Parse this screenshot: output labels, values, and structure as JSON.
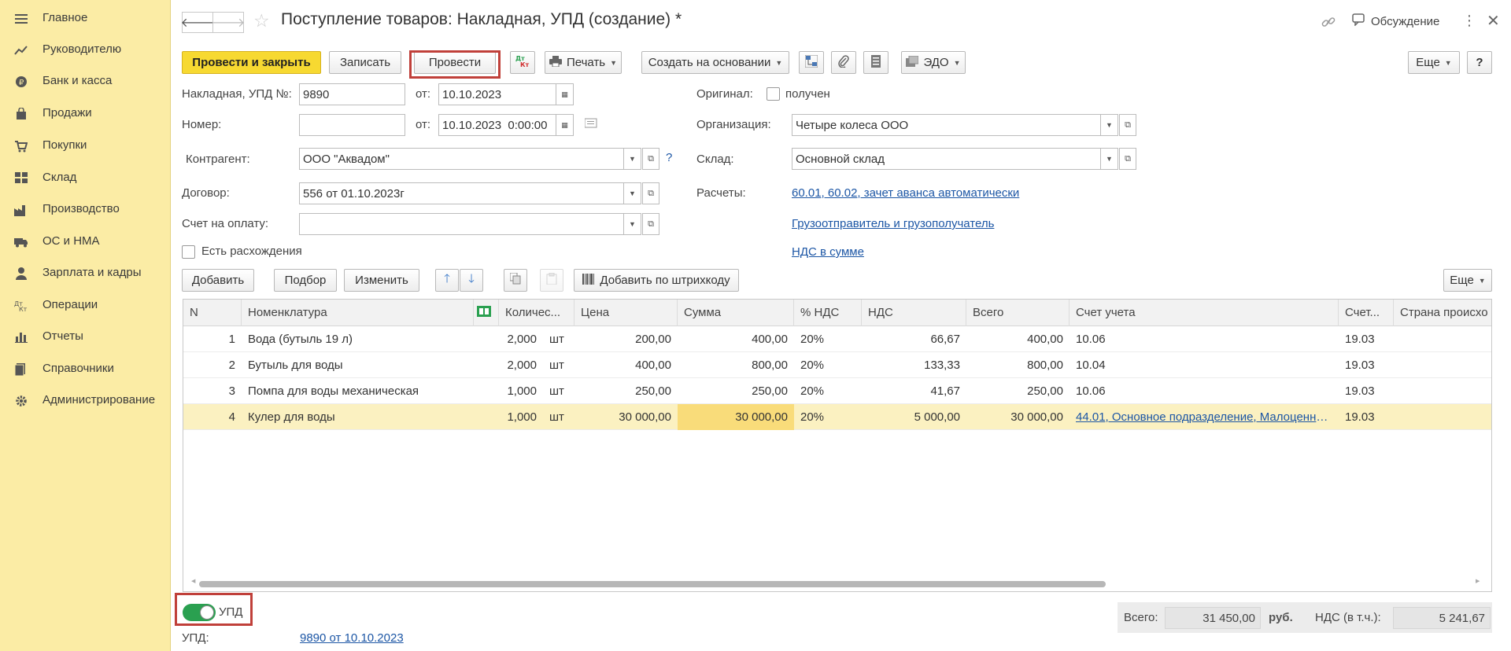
{
  "sidebar": {
    "items": [
      {
        "label": "Главное",
        "icon": "menu-icon"
      },
      {
        "label": "Руководителю",
        "icon": "trend-icon"
      },
      {
        "label": "Банк и касса",
        "icon": "coin-icon"
      },
      {
        "label": "Продажи",
        "icon": "bag-icon"
      },
      {
        "label": "Покупки",
        "icon": "cart-icon"
      },
      {
        "label": "Склад",
        "icon": "warehouse-icon"
      },
      {
        "label": "Производство",
        "icon": "factory-icon"
      },
      {
        "label": "ОС и НМА",
        "icon": "truck-icon"
      },
      {
        "label": "Зарплата и кадры",
        "icon": "person-icon"
      },
      {
        "label": "Операции",
        "icon": "dtkt-icon"
      },
      {
        "label": "Отчеты",
        "icon": "chart-icon"
      },
      {
        "label": "Справочники",
        "icon": "book-icon"
      },
      {
        "label": "Администрирование",
        "icon": "gear-icon"
      }
    ]
  },
  "header": {
    "title": "Поступление товаров: Накладная, УПД (создание) *",
    "discussion": "Обсуждение"
  },
  "toolbar": {
    "post_close": "Провести и закрыть",
    "save": "Записать",
    "post": "Провести",
    "print": "Печать",
    "create_based": "Создать на основании",
    "edo": "ЭДО",
    "more": "Еще",
    "help": "?"
  },
  "form": {
    "invoice_label": "Накладная, УПД №:",
    "invoice_number": "9890",
    "from_label": "от:",
    "invoice_date": "10.10.2023",
    "number_label": "Номер:",
    "number_value": "",
    "from_label2": "от:",
    "number_date": "10.10.2023  0:00:00",
    "counterparty_label": "Контрагент:",
    "counterparty": "ООО \"Аквадом\"",
    "contract_label": "Договор:",
    "contract": "556 от 01.10.2023г",
    "payment_label": "Счет на оплату:",
    "payment_value": "",
    "discrepancy_label": "Есть расхождения",
    "original_label": "Оригинал:",
    "received_label": "получен",
    "organization_label": "Организация:",
    "organization": "Четыре колеса ООО",
    "warehouse_label": "Склад:",
    "warehouse": "Основной склад",
    "settlements_label": "Расчеты:",
    "settlements_link": "60.01, 60.02, зачет аванса автоматически",
    "shipper_link": "Грузоотправитель и грузополучатель",
    "vat_link": "НДС в сумме",
    "help_mark": "?"
  },
  "table_toolbar": {
    "add": "Добавить",
    "pick": "Подбор",
    "edit": "Изменить",
    "barcode": "Добавить по штрихкоду",
    "more": "Еще"
  },
  "table": {
    "headers": [
      "N",
      "Номенклатура",
      "Количес...",
      "Цена",
      "Сумма",
      "% НДС",
      "НДС",
      "Всего",
      "Счет учета",
      "Счет...",
      "Страна происхо"
    ],
    "rows": [
      {
        "n": "1",
        "name": "Вода (бутыль 19 л)",
        "qty": "2,000",
        "unit": "шт",
        "price": "200,00",
        "sum": "400,00",
        "vat_rate": "20%",
        "vat": "66,67",
        "total": "400,00",
        "account": "10.06",
        "acc2": "19.03"
      },
      {
        "n": "2",
        "name": "Бутыль для воды",
        "qty": "2,000",
        "unit": "шт",
        "price": "400,00",
        "sum": "800,00",
        "vat_rate": "20%",
        "vat": "133,33",
        "total": "800,00",
        "account": "10.04",
        "acc2": "19.03"
      },
      {
        "n": "3",
        "name": "Помпа для воды механическая",
        "qty": "1,000",
        "unit": "шт",
        "price": "250,00",
        "sum": "250,00",
        "vat_rate": "20%",
        "vat": "41,67",
        "total": "250,00",
        "account": "10.06",
        "acc2": "19.03"
      },
      {
        "n": "4",
        "name": "Кулер для воды",
        "qty": "1,000",
        "unit": "шт",
        "price": "30 000,00",
        "sum": "30 000,00",
        "vat_rate": "20%",
        "vat": "5 000,00",
        "total": "30 000,00",
        "account": "44.01, Основное подразделение, Малоценно...",
        "acc2": "19.03"
      }
    ]
  },
  "footer": {
    "upd_toggle_label": "УПД",
    "upd_label": "УПД:",
    "upd_link": "9890 от 10.10.2023",
    "total_label": "Всего:",
    "total_value": "31 450,00",
    "currency": "руб.",
    "vat_label": "НДС (в т.ч.):",
    "vat_value": "5 241,67"
  },
  "colors": {
    "sidebar_bg": "#fbeca5",
    "accent_yellow": "#f7d931",
    "highlight_red": "#c0403a",
    "link_blue": "#1c56a5",
    "toggle_green": "#2aa050"
  }
}
